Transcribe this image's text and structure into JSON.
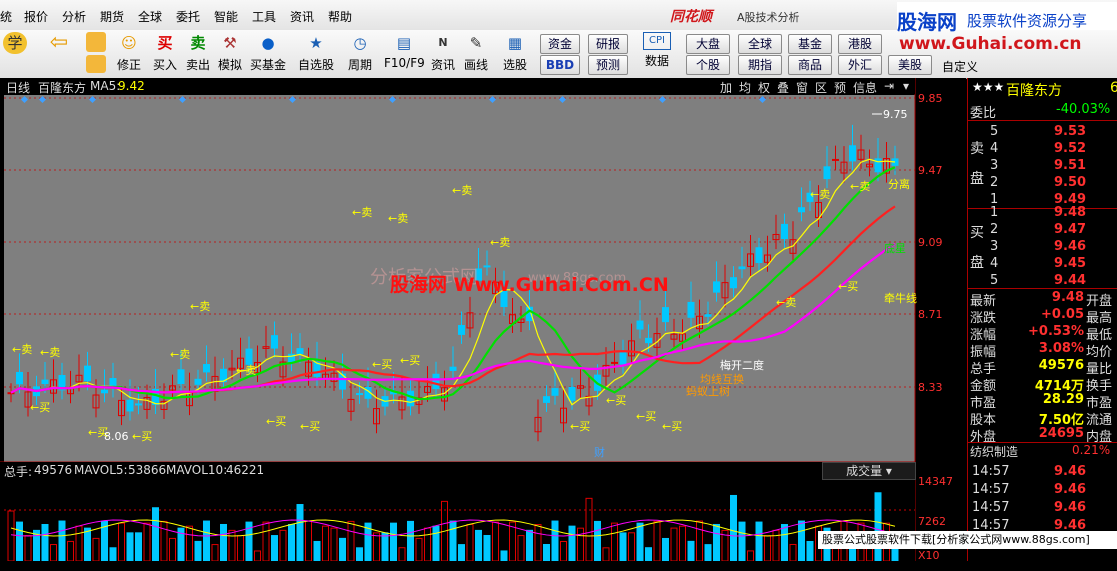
{
  "menu": [
    "统",
    "报价",
    "分析",
    "期货",
    "全球",
    "委托",
    "智能",
    "工具",
    "资讯",
    "帮助"
  ],
  "app_logo": "同花顺",
  "app_subtitle": "A股技术分析",
  "watermark_logo": {
    "main": "股海网",
    "sub": "股票软件资源分享",
    "url": "www.Guhai.com.cn"
  },
  "toolbar": {
    "buttons": [
      "学",
      "",
      "修正",
      "买入",
      "卖出",
      "模拟",
      "买基金",
      "自选股",
      "周期",
      "F10/F9",
      "资讯",
      "画线",
      "选股",
      "数据"
    ],
    "icons": [
      "学",
      "⇦",
      "☺",
      "买",
      "卖",
      "⚒",
      "●",
      "★",
      "◷",
      "▤",
      "N",
      "✎",
      "▦",
      "CPI"
    ],
    "grid": [
      [
        "资金",
        "研报"
      ],
      [
        "BBD",
        "预测"
      ]
    ],
    "grid2": [
      [
        "大盘",
        "全球",
        "基金",
        "港股"
      ],
      [
        "个股",
        "期指",
        "商品",
        "外汇"
      ]
    ],
    "extra": [
      "",
      "美股",
      "自定义"
    ]
  },
  "chart_header": {
    "period": "日线",
    "name": "百隆东方",
    "ma_label": "MA5:",
    "ma_value": "9.42"
  },
  "chart_header_tabs": [
    "加",
    "均",
    "权",
    "叠",
    "窗",
    "区",
    "预",
    "信息",
    "⇥"
  ],
  "price_axis": [
    "9.85",
    "9.47",
    "9.09",
    "8.71",
    "8.33"
  ],
  "annotations": {
    "high": "9.75",
    "low": "8.06",
    "cai": "财",
    "wm1": "股海网 Www.Guhai.Com.CN",
    "wm2": "www.88gs.com",
    "wm3": "分析家公式网",
    "labels": [
      "梅开二度",
      "均线互换",
      "蚂蚁上树",
      "分离",
      "底星",
      "牵牛线"
    ]
  },
  "signals_sell": "←卖",
  "signals_buy": "←买",
  "vol_header": {
    "label": "总手:",
    "value": "49576",
    "mavol5_label": "MAVOL5:",
    "mavol5": "53866",
    "mavol10_label": "MAVOL10:",
    "mavol10": "46221",
    "indicator": "成交量"
  },
  "vol_axis": [
    "14347",
    "7262",
    "X10"
  ],
  "right_panel": {
    "title": "百隆东方",
    "stars": "★★★",
    "code": "6",
    "wei_bi_label": "委比",
    "wei_bi": "-40.03%",
    "sell_label": [
      "卖",
      "盘"
    ],
    "buy_label": [
      "买",
      "盘"
    ],
    "sell": [
      [
        "5",
        "9.53"
      ],
      [
        "4",
        "9.52"
      ],
      [
        "3",
        "9.51"
      ],
      [
        "2",
        "9.50"
      ],
      [
        "1",
        "9.49"
      ]
    ],
    "buy": [
      [
        "1",
        "9.48"
      ],
      [
        "2",
        "9.47"
      ],
      [
        "3",
        "9.46"
      ],
      [
        "4",
        "9.45"
      ],
      [
        "5",
        "9.44"
      ]
    ],
    "stats": [
      [
        "最新",
        "9.48",
        "开盘"
      ],
      [
        "涨跌",
        "+0.05",
        "最高"
      ],
      [
        "涨幅",
        "+0.53%",
        "最低"
      ],
      [
        "振幅",
        "3.08%",
        "均价"
      ],
      [
        "总手",
        "49576",
        "量比"
      ],
      [
        "金额",
        "4714万",
        "换手"
      ],
      [
        "市盈",
        "28.29",
        "市盈"
      ],
      [
        "股本",
        "7.50亿",
        "流通"
      ],
      [
        "外盘",
        "24695",
        "内盘"
      ]
    ],
    "industry": "纺织制造",
    "industry_pct": "0.21%",
    "ticks": [
      [
        "14:57",
        "9.46"
      ],
      [
        "14:57",
        "9.46"
      ],
      [
        "14:57",
        "9.46"
      ],
      [
        "14:57",
        "9.46"
      ]
    ]
  },
  "bottom_banner": "股票公式股票软件下载[分析家公式网www.88gs.com]"
}
